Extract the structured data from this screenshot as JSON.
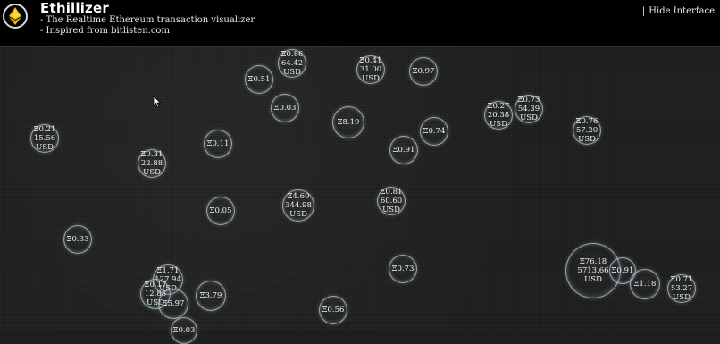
{
  "header": {
    "title": "Ethillizer",
    "subtitle_lines": [
      "- The Realtime Ethereum transaction visualizer",
      "- Inspired from bitlisten.com"
    ],
    "hide_interface_label": "Hide Interface",
    "separator": "|"
  },
  "colors": {
    "background": "#1e1e1e",
    "header_background": "#000000",
    "bubble_border": "#bed2d7",
    "text": "#ffffff"
  },
  "icons": {
    "logo": "ethereum-diamond-icon",
    "cursor": "mouse-pointer-icon"
  },
  "bubbles": [
    {
      "eth": "Ξ0.86",
      "usd": "64.42",
      "unit": "USD"
    },
    {
      "eth": "Ξ0.41",
      "usd": "31.00",
      "unit": "USD"
    },
    {
      "eth": "Ξ0.51",
      "usd": "",
      "unit": ""
    },
    {
      "eth": "Ξ0.97",
      "usd": "",
      "unit": ""
    },
    {
      "eth": "Ξ0.03",
      "usd": "",
      "unit": ""
    },
    {
      "eth": "Ξ8.19",
      "usd": "",
      "unit": ""
    },
    {
      "eth": "Ξ0.27",
      "usd": "20.38",
      "unit": "USD"
    },
    {
      "eth": "Ξ0.73",
      "usd": "54.39",
      "unit": "USD"
    },
    {
      "eth": "Ξ0.76",
      "usd": "57.20",
      "unit": "USD"
    },
    {
      "eth": "Ξ0.21",
      "usd": "15.56",
      "unit": "USD"
    },
    {
      "eth": "Ξ0.74",
      "usd": "",
      "unit": ""
    },
    {
      "eth": "Ξ0.11",
      "usd": "",
      "unit": ""
    },
    {
      "eth": "Ξ0.91",
      "usd": "",
      "unit": ""
    },
    {
      "eth": "Ξ0.31",
      "usd": "22.88",
      "unit": "USD"
    },
    {
      "eth": "Ξ4.60",
      "usd": "344.98",
      "unit": "USD"
    },
    {
      "eth": "Ξ0.81",
      "usd": "60.60",
      "unit": "USD"
    },
    {
      "eth": "Ξ0.05",
      "usd": "",
      "unit": ""
    },
    {
      "eth": "Ξ0.33",
      "usd": "",
      "unit": ""
    },
    {
      "eth": "Ξ0.73",
      "usd": "",
      "unit": ""
    },
    {
      "eth": "Ξ76.18",
      "usd": "5713.66",
      "unit": "USD"
    },
    {
      "eth": "Ξ0.91",
      "usd": "",
      "unit": ""
    },
    {
      "eth": "Ξ1.71",
      "usd": "127.94",
      "unit": "USD"
    },
    {
      "eth": "Ξ0.17",
      "usd": "12.85",
      "unit": "USD"
    },
    {
      "eth": "Ξ5.97",
      "usd": "",
      "unit": ""
    },
    {
      "eth": "Ξ3.79",
      "usd": "",
      "unit": ""
    },
    {
      "eth": "Ξ1.18",
      "usd": "",
      "unit": ""
    },
    {
      "eth": "Ξ0.71",
      "usd": "53.27",
      "unit": "USD"
    },
    {
      "eth": "Ξ0.56",
      "usd": "",
      "unit": ""
    },
    {
      "eth": "Ξ0.03",
      "usd": "",
      "unit": ""
    }
  ]
}
